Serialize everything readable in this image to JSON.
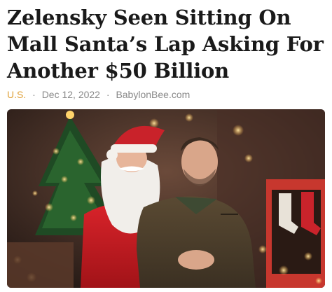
{
  "article": {
    "headline": "Zelensky Seen Sitting On Mall Santa’s Lap Asking For Another $50 Billion",
    "category": "U.S.",
    "separator": "·",
    "date": "Dec 12, 2022",
    "source": "BabylonBee.com"
  },
  "colors": {
    "category": "#e0a23b",
    "meta": "#8a8a8a",
    "headline": "#1a1a1a"
  },
  "hero_image": {
    "icon": "photo-santa-zelensky"
  }
}
